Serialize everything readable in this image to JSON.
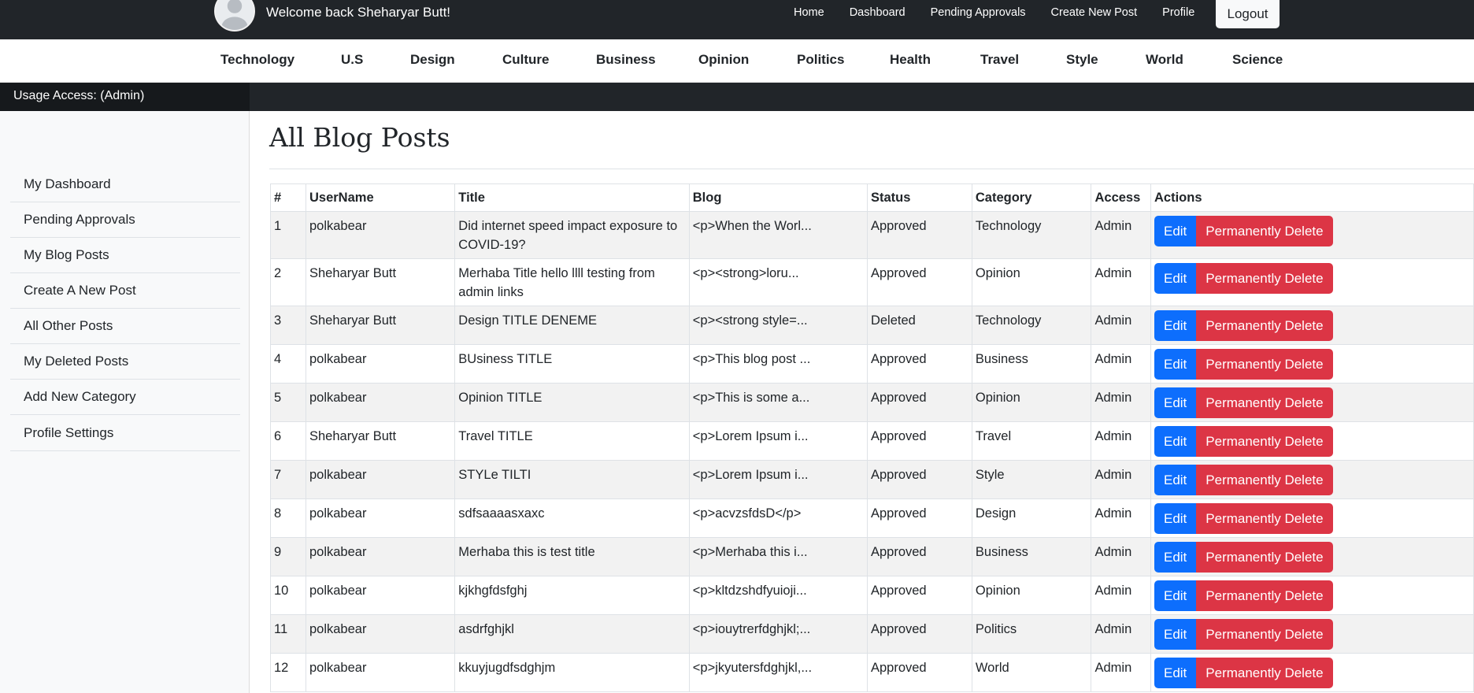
{
  "header": {
    "welcome": "Welcome back Sheharyar Butt!",
    "nav": [
      "Home",
      "Dashboard",
      "Pending Approvals",
      "Create New Post",
      "Profile"
    ],
    "logout": "Logout"
  },
  "categories": [
    "Technology",
    "U.S",
    "Design",
    "Culture",
    "Business",
    "Opinion",
    "Politics",
    "Health",
    "Travel",
    "Style",
    "World",
    "Science"
  ],
  "usage": "Usage Access: (Admin)",
  "sidebar": {
    "items": [
      "My Dashboard",
      "Pending Approvals",
      "My Blog Posts",
      "Create A New Post",
      "All Other Posts",
      "My Deleted Posts",
      "Add New Category",
      "Profile Settings"
    ]
  },
  "main": {
    "title": "All Blog Posts",
    "columns": [
      "#",
      "UserName",
      "Title",
      "Blog",
      "Status",
      "Category",
      "Access",
      "Actions"
    ],
    "edit_label": "Edit",
    "delete_label": "Permanently Delete",
    "rows": [
      {
        "num": "1",
        "user": "polkabear",
        "title": "Did internet speed impact exposure to COVID-19?",
        "blog": "<p>When the Worl...",
        "status": "Approved",
        "category": "Technology",
        "access": "Admin"
      },
      {
        "num": "2",
        "user": "Sheharyar Butt",
        "title": "Merhaba Title hello llll testing from admin links",
        "blog": "<p><strong>loru...",
        "status": "Approved",
        "category": "Opinion",
        "access": "Admin"
      },
      {
        "num": "3",
        "user": "Sheharyar Butt",
        "title": "Design TITLE DENEME",
        "blog": "<p><strong style=...",
        "status": "Deleted",
        "category": "Technology",
        "access": "Admin"
      },
      {
        "num": "4",
        "user": "polkabear",
        "title": "BUsiness TITLE",
        "blog": "<p>This blog post ...",
        "status": "Approved",
        "category": "Business",
        "access": "Admin"
      },
      {
        "num": "5",
        "user": "polkabear",
        "title": "Opinion TITLE",
        "blog": "<p>This is some a...",
        "status": "Approved",
        "category": "Opinion",
        "access": "Admin"
      },
      {
        "num": "6",
        "user": "Sheharyar Butt",
        "title": "Travel TITLE",
        "blog": "<p>Lorem Ipsum i...",
        "status": "Approved",
        "category": "Travel",
        "access": "Admin"
      },
      {
        "num": "7",
        "user": "polkabear",
        "title": "STYLe TILTI",
        "blog": "<p>Lorem Ipsum i...",
        "status": "Approved",
        "category": "Style",
        "access": "Admin"
      },
      {
        "num": "8",
        "user": "polkabear",
        "title": "sdfsaaaasxaxc",
        "blog": "<p>acvzsfdsD</p>",
        "status": "Approved",
        "category": "Design",
        "access": "Admin"
      },
      {
        "num": "9",
        "user": "polkabear",
        "title": "Merhaba this is test title",
        "blog": "<p>Merhaba this i...",
        "status": "Approved",
        "category": "Business",
        "access": "Admin"
      },
      {
        "num": "10",
        "user": "polkabear",
        "title": "kjkhgfdsfghj",
        "blog": "<p>kltdzshdfyuioji...",
        "status": "Approved",
        "category": "Opinion",
        "access": "Admin"
      },
      {
        "num": "11",
        "user": "polkabear",
        "title": "asdrfghjkl",
        "blog": "<p>iouytrerfdghjkl;...",
        "status": "Approved",
        "category": "Politics",
        "access": "Admin"
      },
      {
        "num": "12",
        "user": "polkabear",
        "title": "kkuyjugdfsdghjm",
        "blog": "<p>jkyutersfdghjkl,...",
        "status": "Approved",
        "category": "World",
        "access": "Admin"
      }
    ]
  }
}
